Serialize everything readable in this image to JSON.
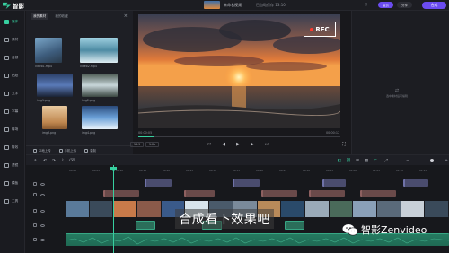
{
  "app": {
    "name": "智影",
    "project_name": "未命名视频",
    "save_status": "已自动保存 13:10",
    "help": "?",
    "btn_upgrade": "会员",
    "btn_share": "分享",
    "btn_export": "合成"
  },
  "nav": {
    "items": [
      {
        "label": "媒体"
      },
      {
        "label": "素材"
      },
      {
        "label": "音频"
      },
      {
        "label": "贴纸"
      },
      {
        "label": "文字"
      },
      {
        "label": "字幕"
      },
      {
        "label": "转场"
      },
      {
        "label": "特效"
      },
      {
        "label": "滤镜"
      },
      {
        "label": "模板"
      },
      {
        "label": "工具"
      }
    ]
  },
  "media": {
    "tabs": [
      "我的素材",
      "我的收藏"
    ],
    "close": "×",
    "items": [
      {
        "label": "video1.mp4"
      },
      {
        "label": "video2.mp4"
      },
      {
        "label": "img1.png"
      },
      {
        "label": "img2.png"
      },
      {
        "label": "img3.png"
      },
      {
        "label": "img4.png"
      }
    ],
    "footer": [
      "本地上传",
      "手机上传",
      "录制"
    ]
  },
  "preview": {
    "rec_label": "REC",
    "time_current": "00:00:05",
    "time_total": "00:00:12",
    "progress": 0.08,
    "ratio_chip": "16:9",
    "speed_chip": "1.0x"
  },
  "right_panel": {
    "empty_text": "选中素材后可编辑"
  },
  "timeline": {
    "ruler": [
      "00:00",
      "00:05",
      "00:10",
      "00:15",
      "00:20",
      "00:25",
      "00:30",
      "00:35",
      "00:40",
      "00:45",
      "00:50",
      "00:55",
      "01:00",
      "01:05",
      "01:10",
      "01:15"
    ]
  },
  "overlay": {
    "subtitle": "合成看下效果吧",
    "watermark": "智影Zenvideo"
  },
  "colors": {
    "accent": "#37d0a0",
    "brand": "#6b4cf0",
    "rec_dot": "#ff3b30"
  }
}
